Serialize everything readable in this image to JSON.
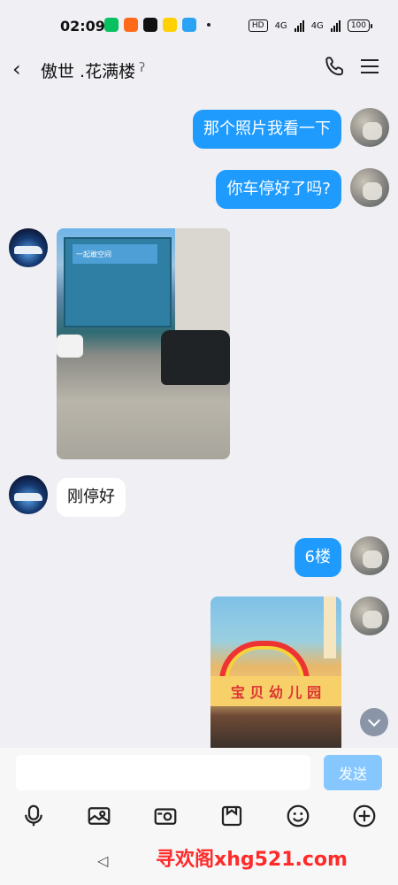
{
  "status_bar": {
    "time": "02:09",
    "app_icons": [
      "wechat-style-icon",
      "weibo-icon",
      "chat-icon",
      "meituan-icon",
      "cloud-icon"
    ],
    "network": [
      "HD",
      "4G",
      "4G"
    ],
    "battery": "100"
  },
  "header": {
    "back_icon": "back-icon",
    "title": "傲世 .花满楼",
    "phone_icon": "phone-icon",
    "menu_icon": "menu-icon"
  },
  "messages": [
    {
      "from": "me",
      "type": "text",
      "text": "那个照片我看一下"
    },
    {
      "from": "me",
      "type": "text",
      "text": "你车停好了吗?"
    },
    {
      "from": "other",
      "type": "image",
      "image_text": "一起敢空间"
    },
    {
      "from": "other",
      "type": "text",
      "text": "刚停好"
    },
    {
      "from": "me",
      "type": "text",
      "text": "6楼"
    },
    {
      "from": "me",
      "type": "image",
      "image_text": "宝 贝 幼 儿 园"
    }
  ],
  "input": {
    "placeholder": "",
    "send_label": "发送"
  },
  "toolbar": {
    "icons": [
      "microphone-icon",
      "image-icon",
      "camera-icon",
      "file-icon",
      "emoji-icon",
      "add-icon"
    ]
  },
  "system_nav": {
    "back_symbol": "◁"
  },
  "watermark": "寻欢阁xhg521.com",
  "colors": {
    "my_bubble": "#1f9bfe",
    "background": "#efeff4",
    "send_button": "#86c7ff"
  }
}
